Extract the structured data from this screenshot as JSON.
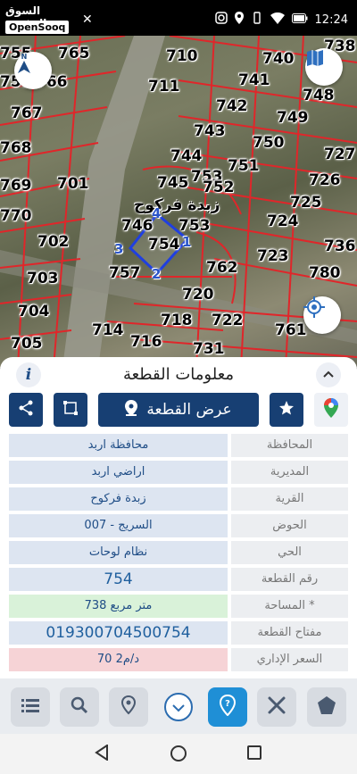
{
  "status_bar": {
    "app_logo_ar": "السوق المفتوح",
    "app_logo_en": "OpenSooq",
    "time": "12:24"
  },
  "map": {
    "village_label": "زبدة فركوح",
    "parcel_labels": [
      "738",
      "765",
      "755",
      "710",
      "740",
      "759",
      "766",
      "711",
      "741",
      "748",
      "767",
      "742",
      "749",
      "743",
      "768",
      "750",
      "744",
      "751",
      "727",
      "769",
      "701",
      "745",
      "753",
      "752",
      "726",
      "770",
      "746",
      "753",
      "724",
      "725",
      "702",
      "754",
      "736",
      "723",
      "703",
      "757",
      "762",
      "780",
      "720",
      "704",
      "722",
      "714",
      "718",
      "716",
      "705",
      "761",
      "731"
    ],
    "vertices": [
      "1",
      "2",
      "3",
      "4"
    ],
    "colors": {
      "parcel_line": "#e0262a",
      "selection": "#1f3fe0"
    }
  },
  "sheet": {
    "title": "معلومات القطعة",
    "info_label": "i",
    "show_parcel_label": "عرض القطعة",
    "rows": [
      {
        "label": "المحافظة",
        "value": "محافظة اربد"
      },
      {
        "label": "المديرية",
        "value": "اراضي اربد"
      },
      {
        "label": "القرية",
        "value": "زبدة فركوح"
      },
      {
        "label": "الحوض",
        "value": "السريج - 007"
      },
      {
        "label": "الحي",
        "value": "نظام لوحات"
      },
      {
        "label": "رقم القطعة",
        "value": "754"
      },
      {
        "label": "المساحة *",
        "value": "738  متر مربع"
      },
      {
        "label": "مفتاح القطعة",
        "value": "019300704500754"
      },
      {
        "label": "السعر الإداري",
        "value": "70 د/م2"
      }
    ]
  },
  "colors": {
    "primary": "#173f73",
    "accent": "#1f8fd6"
  }
}
